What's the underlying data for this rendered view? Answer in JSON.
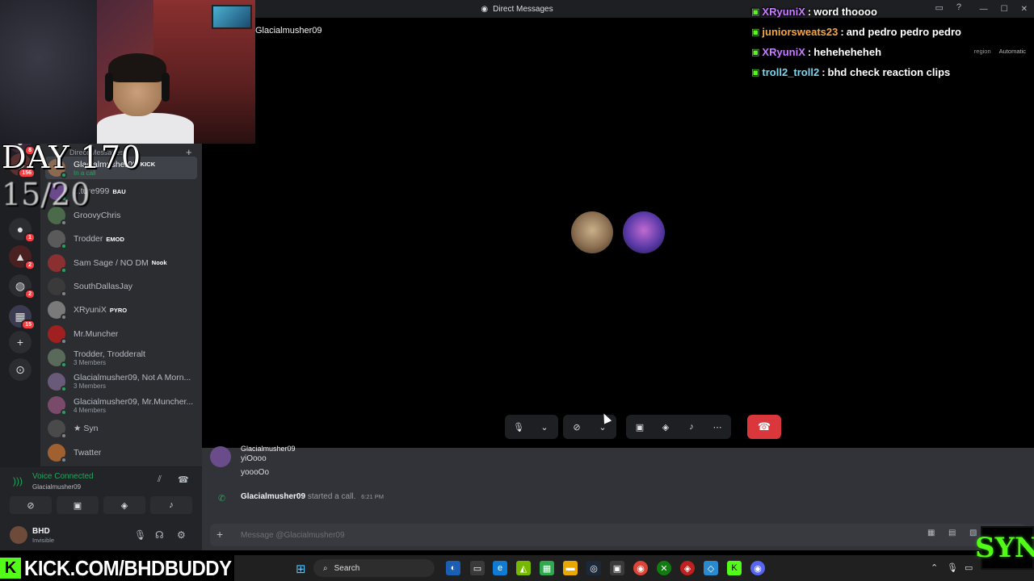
{
  "titlebar": {
    "title": "Direct Messages",
    "icon": "discord-icon"
  },
  "window_controls": {
    "minimize": "—",
    "maximize": "☐",
    "close": "✕"
  },
  "rail": {
    "items": [
      {
        "icon": "server-icon",
        "badge": "8"
      },
      {
        "icon": "server-icon",
        "badge": "156"
      },
      {
        "icon": "server-icon",
        "badge": "1"
      },
      {
        "icon": "server-icon",
        "badge": "2"
      },
      {
        "icon": "server-icon",
        "badge": "2"
      },
      {
        "icon": "server-icon",
        "badge": "15"
      },
      {
        "icon": "add-server-icon",
        "badge": ""
      },
      {
        "icon": "compass-icon",
        "badge": ""
      }
    ]
  },
  "dm": {
    "header": "Direct Messages",
    "items": [
      {
        "name": "Glacialmusher09",
        "tag": "KICK",
        "sub": "In a call",
        "avatar": "#8a6a50",
        "online": true,
        "active": true
      },
      {
        "name": "...ture999",
        "tag": "BAU",
        "sub": "",
        "avatar": "#6a4a8a",
        "online": true,
        "active": false
      },
      {
        "name": "GroovyChris",
        "tag": "",
        "sub": "",
        "avatar": "#4a6a4a",
        "online": false,
        "active": false
      },
      {
        "name": "Trodder",
        "tag": "EMOD",
        "sub": "",
        "avatar": "#5a5a5a",
        "online": true,
        "active": false
      },
      {
        "name": "Sam Sage / NO DM",
        "tag": "Nook",
        "sub": "",
        "avatar": "#8a3030",
        "online": true,
        "active": false
      },
      {
        "name": "SouthDallasJay",
        "tag": "",
        "sub": "",
        "avatar": "#3a3a3a",
        "online": false,
        "active": false
      },
      {
        "name": "XRyuniX",
        "tag": "PYRO",
        "sub": "",
        "avatar": "#7a7a7a",
        "online": false,
        "active": false
      },
      {
        "name": "Mr.Muncher",
        "tag": "",
        "sub": "",
        "avatar": "#a02020",
        "online": false,
        "active": false
      },
      {
        "name": "Trodder, Trodderalt",
        "tag": "",
        "sub": "3 Members",
        "avatar": "#5a6a5a",
        "online": true,
        "active": false
      },
      {
        "name": "Glacialmusher09, Not A Morn...",
        "tag": "",
        "sub": "3 Members",
        "avatar": "#6a5a7a",
        "online": true,
        "active": false
      },
      {
        "name": "Glacialmusher09, Mr.Muncher...",
        "tag": "",
        "sub": "4 Members",
        "avatar": "#7a4a6a",
        "online": true,
        "active": false
      },
      {
        "name": "★ Syn",
        "tag": "",
        "sub": "",
        "avatar": "#4a4a4a",
        "online": false,
        "active": false
      },
      {
        "name": "Twatter",
        "tag": "",
        "sub": "",
        "avatar": "#a06030",
        "online": false,
        "active": false
      }
    ]
  },
  "voice": {
    "title": "Voice Connected",
    "channel": "Glacialmusher09",
    "buttons": [
      "camera-off-icon",
      "screen-share-icon",
      "activity-icon",
      "soundboard-icon"
    ]
  },
  "user": {
    "name": "BHD",
    "status": "Invisible"
  },
  "call": {
    "name": "Glacialmusher09",
    "region_label": "region",
    "region_value": "Automatic",
    "participants": [
      "participant-dog",
      "participant-pixel"
    ]
  },
  "chat": {
    "author": "Glacialmusher09",
    "messages": [
      "yiOooo",
      "yoooOo"
    ],
    "system": {
      "user": "Glacialmusher09",
      "text": "started a call.",
      "time": "6:21 PM"
    },
    "placeholder": "Message @Glacialmusher09"
  },
  "overlay": {
    "day": "DAY 170",
    "count": "15/20",
    "chat": [
      {
        "user": "XRyuniX",
        "text": "word thoooo",
        "color": "#c77dff"
      },
      {
        "user": "juniorsweats23",
        "text": "and pedro pedro pedro",
        "color": "#f4a742"
      },
      {
        "user": "XRyuniX",
        "text": "heheheheheh",
        "color": "#c77dff"
      },
      {
        "user": "troll2_troll2",
        "text": "bhd check reaction clips",
        "color": "#7ad7f0"
      }
    ],
    "kick_url": "KICK.COM/BHDBUDDY",
    "syn_logo": "SYN"
  },
  "taskbar": {
    "search": "Search"
  },
  "colors": {
    "accent": "#23a55a",
    "danger": "#da373c",
    "kick": "#53fc18"
  }
}
